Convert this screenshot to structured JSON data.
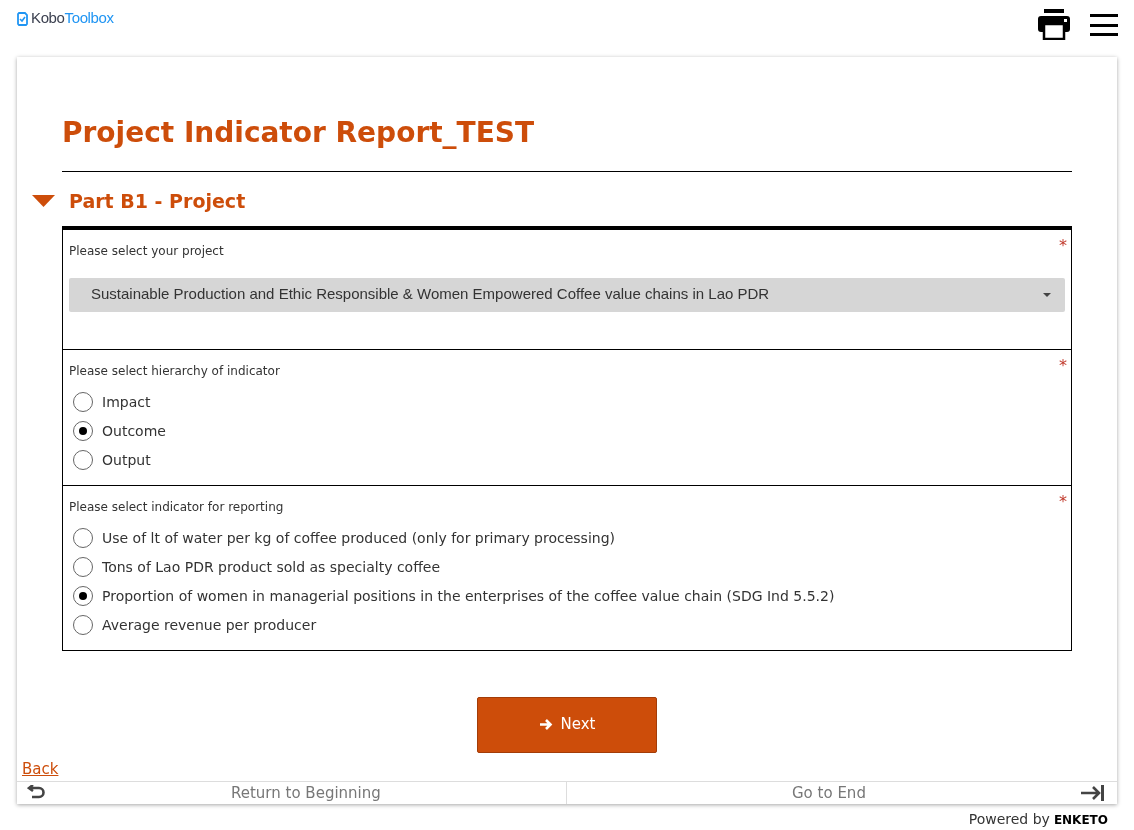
{
  "header": {
    "logo_dark": "Kobo",
    "logo_light": "Toolbox"
  },
  "form": {
    "title": "Project Indicator Report_TEST",
    "group": {
      "title": "Part B1 - Project",
      "expanded": true,
      "questions": [
        {
          "kind": "select",
          "label": "Please select your project",
          "required_mark": "*",
          "value": "Sustainable Production and Ethic Responsible & Women Empowered Coffee value chains in Lao PDR"
        },
        {
          "kind": "radio",
          "label": "Please select hierarchy of indicator",
          "required_mark": "*",
          "options": [
            {
              "label": "Impact",
              "selected": false
            },
            {
              "label": "Outcome",
              "selected": true
            },
            {
              "label": "Output",
              "selected": false
            }
          ]
        },
        {
          "kind": "radio",
          "label": "Please select indicator for reporting",
          "required_mark": "*",
          "options": [
            {
              "label": "Use of lt of water per kg of coffee produced (only for primary processing)",
              "selected": false
            },
            {
              "label": "Tons of Lao PDR product sold as specialty coffee",
              "selected": false
            },
            {
              "label": "Proportion of women in managerial positions in the enterprises of the coffee value chain (SDG Ind 5.5.2)",
              "selected": true
            },
            {
              "label": "Average revenue per producer",
              "selected": false
            }
          ]
        }
      ]
    },
    "next_button": "Next",
    "back_link": "Back"
  },
  "footer_nav": {
    "return": "Return to Beginning",
    "end": "Go to End"
  },
  "powered_by": {
    "text": "Powered by",
    "brand": "ENKETO"
  }
}
